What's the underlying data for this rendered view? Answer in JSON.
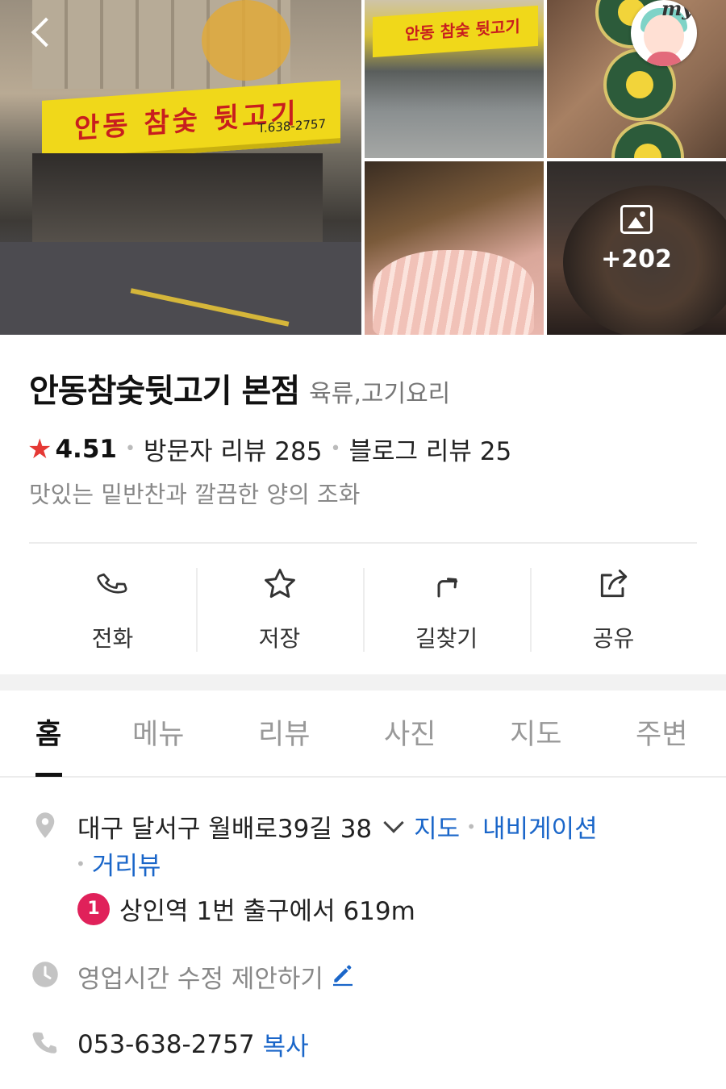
{
  "gallery": {
    "main_sign_text": "안동 참숯 뒷고기",
    "main_sign_phone": "T.638-2757",
    "thumb_sign_text": "안동 참숯 뒷고기",
    "more_count": "+202"
  },
  "header": {
    "my_label": "my"
  },
  "place": {
    "name": "안동참숯뒷고기 본점",
    "category": "육류,고기요리",
    "rating": "4.51",
    "visitor_reviews": "방문자 리뷰 285",
    "blog_reviews": "블로그 리뷰 25",
    "description": "맛있는 밑반찬과 깔끔한 양의 조화"
  },
  "actions": [
    {
      "label": "전화",
      "icon": "phone-icon"
    },
    {
      "label": "저장",
      "icon": "star-outline-icon"
    },
    {
      "label": "길찾기",
      "icon": "directions-icon"
    },
    {
      "label": "공유",
      "icon": "share-icon"
    }
  ],
  "tabs": [
    {
      "label": "홈",
      "active": true
    },
    {
      "label": "메뉴"
    },
    {
      "label": "리뷰"
    },
    {
      "label": "사진"
    },
    {
      "label": "지도"
    },
    {
      "label": "주변"
    }
  ],
  "details": {
    "address": "대구 달서구 월배로39길 38",
    "map_link": "지도",
    "navigation_link": "내비게이션",
    "street_view_link": "거리뷰",
    "subway_line": "1",
    "subway_text": "상인역 1번 출구에서 619m",
    "hours_text": "영업시간 수정 제안하기",
    "phone": "053-638-2757",
    "copy_label": "복사"
  },
  "colors": {
    "accent_link": "#1a66c9",
    "star": "#e53935",
    "subway_line1": "#e0215a"
  }
}
